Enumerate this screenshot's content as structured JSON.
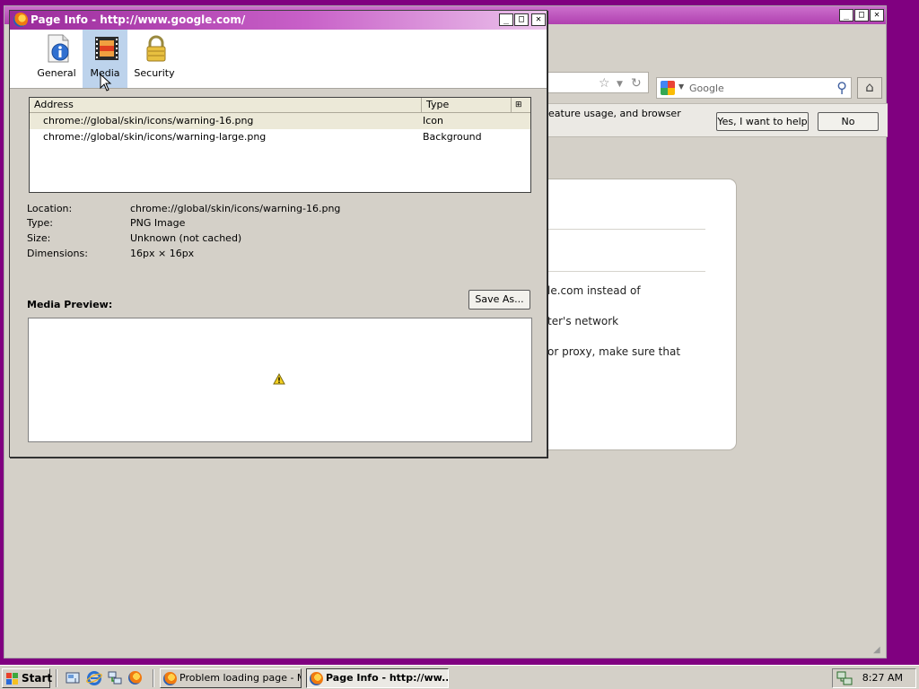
{
  "background_window": {
    "search_placeholder": "Google",
    "notification_text": "eature usage, and browser",
    "yes_button": "Yes, I want to help",
    "no_button": "No",
    "error_fragments": [
      "le.com instead of",
      "ter's network",
      "or proxy, make sure that"
    ],
    "controls": {
      "minimize": "_",
      "maximize": "□",
      "close": "✕"
    }
  },
  "dialog": {
    "title": "Page Info - http://www.google.com/",
    "controls": {
      "minimize": "_",
      "maximize": "□",
      "close": "✕"
    },
    "tabs": [
      {
        "label": "General",
        "icon": "info-icon"
      },
      {
        "label": "Media",
        "icon": "media-film-icon",
        "selected": true
      },
      {
        "label": "Security",
        "icon": "padlock-icon"
      }
    ],
    "media_table": {
      "columns": [
        "Address",
        "Type"
      ],
      "rows": [
        {
          "address": "chrome://global/skin/icons/warning-16.png",
          "type": "Icon",
          "selected": true
        },
        {
          "address": "chrome://global/skin/icons/warning-large.png",
          "type": "Background"
        }
      ]
    },
    "properties": [
      {
        "label": "Location:",
        "value": "chrome://global/skin/icons/warning-16.png"
      },
      {
        "label": "Type:",
        "value": "PNG Image"
      },
      {
        "label": "Size:",
        "value": "Unknown (not cached)"
      },
      {
        "label": "Dimensions:",
        "value": "16px × 16px"
      }
    ],
    "preview_label": "Media Preview:",
    "save_as": "Save As..."
  },
  "taskbar": {
    "start": "Start",
    "tasks": [
      {
        "label": "Problem loading page - M...",
        "active": false
      },
      {
        "label": "Page Info - http://ww...",
        "active": true
      }
    ],
    "clock": "8:27 AM"
  },
  "colors": {
    "desktop": "#800080",
    "window_face": "#d4d0c8",
    "selected_tab": "#bdd3ec"
  }
}
